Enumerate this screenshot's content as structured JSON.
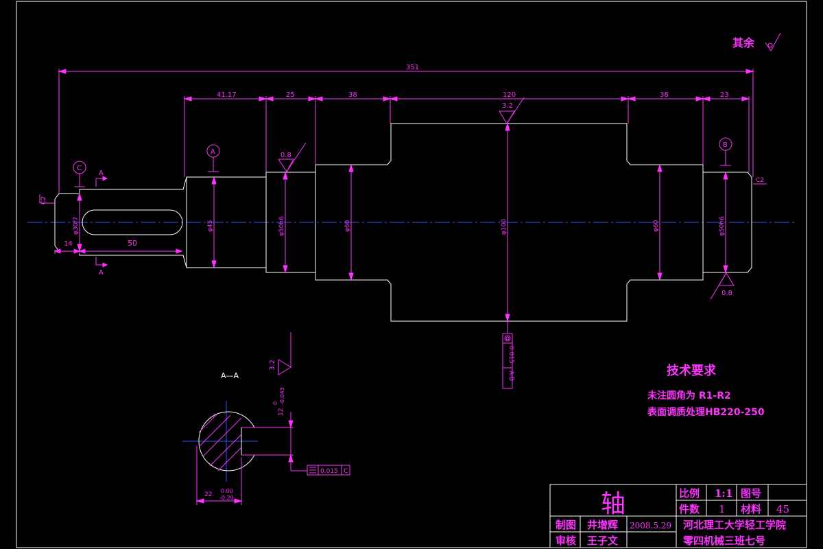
{
  "roughness_other": "其余",
  "dimensions": {
    "overall_length": "351",
    "seg1": "41.17",
    "seg2": "25",
    "seg3": "38",
    "seg4": "120",
    "seg5": "38",
    "seg6": "23",
    "key_offset": "14",
    "key_length": "50",
    "chamfer_left": "C2",
    "chamfer_right": "C2",
    "dia_30": "φ30f7",
    "dia_45": "φ45",
    "dia_50_left": "φ50h6",
    "dia_60_left": "φ60",
    "dia_100": "φ100",
    "dia_60_right": "φ60",
    "dia_50_right": "φ50h6"
  },
  "roughness": {
    "r1": "0.8",
    "r2": "3.2",
    "r3": "0.8",
    "r4": "3.2"
  },
  "datums": {
    "a": "A",
    "b": "B",
    "c": "C"
  },
  "section_marks": {
    "top": "A",
    "bottom": "A",
    "view_title": "A—A"
  },
  "tolerance_frames": {
    "runout_value": "0.015",
    "runout_datum": "A-B",
    "sym_value": "0.015",
    "sym_datum": "C"
  },
  "section_dims": {
    "keyway_width": "12",
    "keyway_width_upper": "0",
    "keyway_width_lower": "-0.043",
    "depth": "22",
    "depth_upper": "0.00",
    "depth_lower": "-0.20"
  },
  "tech_req": {
    "title": "技术要求",
    "line1": "未注圆角为 R1-R2",
    "line2": "表面调质处理HB220-250"
  },
  "title_block": {
    "part_name": "轴",
    "scale_label": "比例",
    "scale_value": "1:1",
    "drawing_no_label": "图号",
    "drawing_no_value": "",
    "qty_label": "件数",
    "qty_value": "1",
    "material_label": "材料",
    "material_value": "45",
    "drawn_label": "制图",
    "drawn_by": "井增辉",
    "date": "2008.5.29",
    "reviewed_label": "审核",
    "reviewed_by": "王子文",
    "school": "河北理工大学轻工学院",
    "class": "零四机械三班七号"
  },
  "colors": {
    "background": "#000000",
    "outline": "#ffffff",
    "dimension": "#ff33ff",
    "centerline": "#3355ff"
  }
}
